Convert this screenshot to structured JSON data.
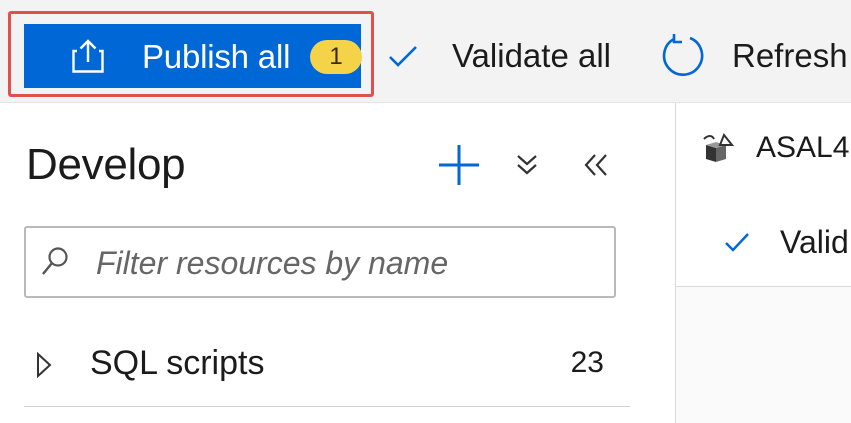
{
  "toolbar": {
    "publish_all_label": "Publish all",
    "publish_all_badge": "1",
    "validate_all_label": "Validate all",
    "refresh_label": "Refresh",
    "icons": {
      "publish": "upload-icon",
      "validate": "checkmark-icon",
      "refresh": "refresh-icon"
    }
  },
  "develop_panel": {
    "title": "Develop",
    "search": {
      "placeholder": "Filter resources by name",
      "value": ""
    },
    "tree": [
      {
        "label": "SQL scripts",
        "count": "23",
        "expanded": false
      }
    ]
  },
  "editor_panel": {
    "tab_label": "ASAL4",
    "validate_label": "Valid"
  },
  "colors": {
    "accent_blue": "#0067d6",
    "badge_yellow": "#f5d349",
    "highlight_red": "#e2504c",
    "toolbar_bg": "#f3f3f3"
  }
}
